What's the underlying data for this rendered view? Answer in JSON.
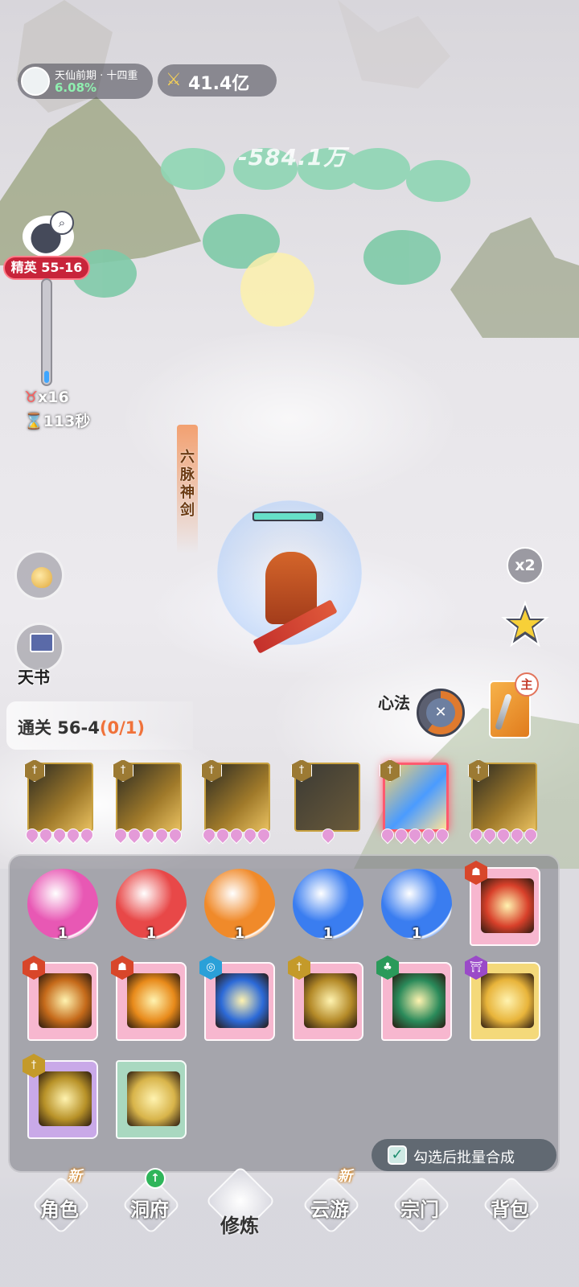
{
  "status": {
    "realm_title": "天仙前期 · 十四重",
    "realm_percent": "6.08%",
    "power_icon": "crossed-swords-icon",
    "power_value": "41.4亿"
  },
  "battle": {
    "damage_text": "-584.1万",
    "stage_badge": "精英 55-16",
    "stage_progress": 0.12,
    "kill_count": "x16",
    "time_left": "113秒",
    "skill_banner": "六脉神剑",
    "hero_hp": 0.92
  },
  "side_buttons": {
    "tianshu_label": "天书",
    "speed_label": "x2",
    "xinfa_label": "心法",
    "main_badge": "主"
  },
  "stage": {
    "label": "通关 56-4",
    "progress": "(0/1)"
  },
  "equipped_skills": [
    {
      "element": "sword",
      "gems": 5,
      "active": false
    },
    {
      "element": "sword",
      "gems": 5,
      "active": false
    },
    {
      "element": "sword",
      "gems": 5,
      "active": false
    },
    {
      "element": "sword",
      "gems": 1,
      "active": false
    },
    {
      "element": "sword",
      "gems": 5,
      "active": true
    },
    {
      "element": "sword",
      "gems": 5,
      "active": false
    }
  ],
  "inventory": {
    "orbs": [
      {
        "color": "#e858b4",
        "count": "1"
      },
      {
        "color": "#e84848",
        "count": "1"
      },
      {
        "color": "#f08a2a",
        "count": "1"
      },
      {
        "color": "#3a7df0",
        "count": "1"
      },
      {
        "color": "#3a7df0",
        "count": "1"
      }
    ],
    "books": [
      {
        "badge": "fire",
        "cover": "#f7b7cf",
        "art": "#d8402a"
      },
      {
        "badge": "fire",
        "cover": "#f7b7cf",
        "art": "#c56a1a"
      },
      {
        "badge": "fire",
        "cover": "#f7b7cf",
        "art": "#e88a1a"
      },
      {
        "badge": "water",
        "cover": "#f7b7cf",
        "art": "#2c6ad8"
      },
      {
        "badge": "sword",
        "cover": "#f7b7cf",
        "art": "#b48a28"
      },
      {
        "badge": "wood",
        "cover": "#f7b7cf",
        "art": "#2a8a5a"
      },
      {
        "badge": "temple",
        "cover": "#f4d97a",
        "art": "#e8b43a"
      },
      {
        "badge": "sword",
        "cover": "#c9a9e8",
        "art": "#b89228"
      },
      {
        "badge": "none",
        "cover": "#a9d8c0",
        "art": "#d8b44a"
      }
    ],
    "batch_label": "勾选后批量合成",
    "batch_checked": true
  },
  "nav": {
    "items": [
      {
        "label": "角色",
        "tag": "新"
      },
      {
        "label": "洞府",
        "tag": "up"
      },
      {
        "label": "修炼",
        "tag": ""
      },
      {
        "label": "云游",
        "tag": "新"
      },
      {
        "label": "宗门",
        "tag": ""
      },
      {
        "label": "背包",
        "tag": ""
      }
    ],
    "active_index": 2
  }
}
